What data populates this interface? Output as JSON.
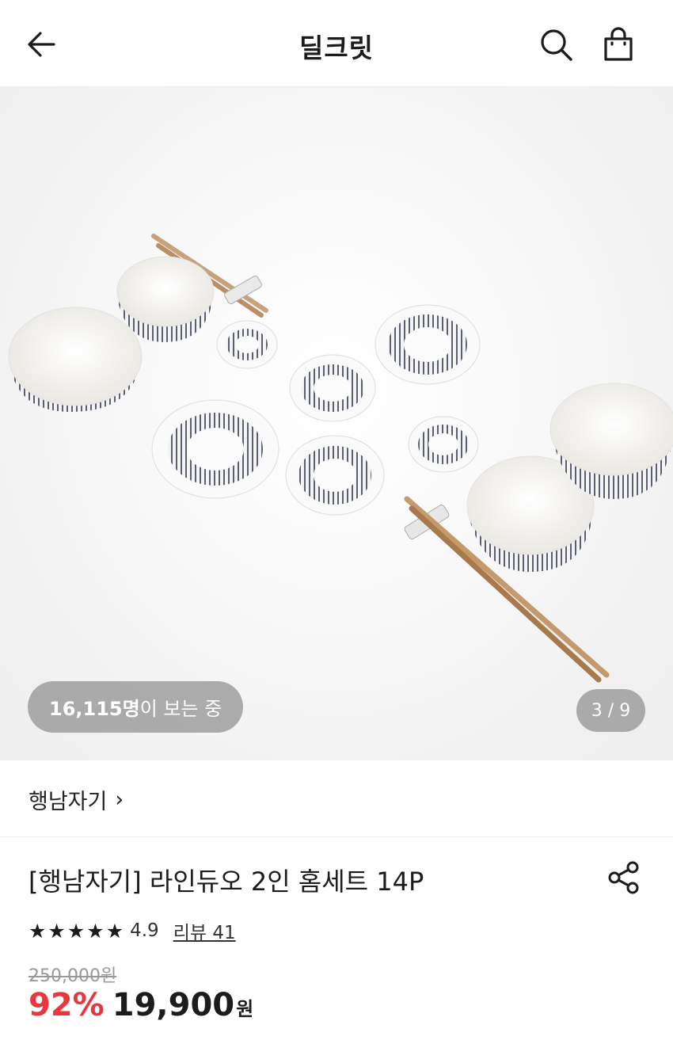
{
  "header": {
    "title": "딜크릿",
    "back_icon": "arrow-left-icon",
    "search_icon": "search-icon",
    "cart_icon": "shopping-bag-icon"
  },
  "gallery": {
    "viewers_count": "16,115명",
    "viewers_suffix": "이 보는 중",
    "page_indicator": "3 / 9",
    "current_index": 3,
    "total": 9
  },
  "brand": {
    "name": "행남자기",
    "chevron": "›"
  },
  "product": {
    "title": "[행남자기] 라인듀오 2인 홈세트 14P",
    "share_icon": "share-icon"
  },
  "rating": {
    "stars": 5,
    "value": "4.9",
    "review_label": "리뷰 41"
  },
  "pricing": {
    "original_price": "250,000원",
    "discount": "92%",
    "price": "19,900",
    "currency": "원"
  },
  "colors": {
    "discount": "#e8373e",
    "text": "#1c1c1c",
    "badge_bg": "#969696"
  }
}
